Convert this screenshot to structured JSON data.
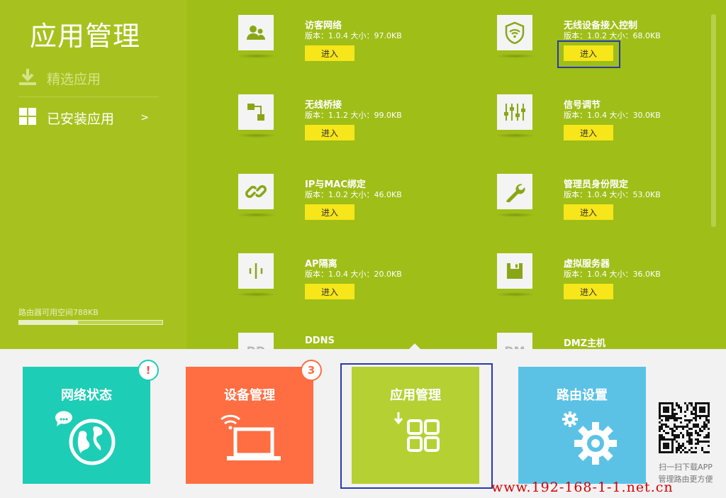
{
  "sidebar": {
    "title": "应用管理",
    "items": [
      {
        "label": "精选应用",
        "icon": "download-icon"
      },
      {
        "label": "已安装应用",
        "icon": "grid-icon",
        "chevron": ">"
      }
    ],
    "space_label": "路由器可用空间788KB",
    "space_used_fraction": 0.41
  },
  "apps": [
    {
      "name": "访客网络",
      "version": "版本：1.0.4 大小：97.0KB",
      "button": "进入",
      "icon": "guest-users-icon"
    },
    {
      "name": "无线设备接入控制",
      "version": "版本：1.0.2 大小：68.0KB",
      "button": "进入",
      "icon": "wifi-shield-icon",
      "focused": true
    },
    {
      "name": "无线桥接",
      "version": "版本：1.1.2 大小：99.0KB",
      "button": "进入",
      "icon": "bridge-icon"
    },
    {
      "name": "信号调节",
      "version": "版本：1.0.4 大小：30.0KB",
      "button": "进入",
      "icon": "signal-sliders-icon"
    },
    {
      "name": "IP与MAC绑定",
      "version": "版本：1.0.2 大小：46.0KB",
      "button": "进入",
      "icon": "link-icon"
    },
    {
      "name": "管理员身份限定",
      "version": "版本：1.0.4 大小：53.0KB",
      "button": "进入",
      "icon": "wrench-icon"
    },
    {
      "name": "AP隔离",
      "version": "版本：1.0.4 大小：20.0KB",
      "button": "进入",
      "icon": "ap-isolation-icon"
    },
    {
      "name": "虚拟服务器",
      "version": "版本：1.0.4 大小：36.0KB",
      "button": "进入",
      "icon": "save-disk-icon"
    },
    {
      "name": "DDNS",
      "icon_text": "DD",
      "icon": "ddns-icon"
    },
    {
      "name": "DMZ主机",
      "icon_text": "DM",
      "icon": "dmz-icon"
    }
  ],
  "tiles": [
    {
      "label": "网络状态",
      "color": "#1ecdb5",
      "icon": "globe-chat-icon",
      "badge": "!"
    },
    {
      "label": "设备管理",
      "color": "#ff6e42",
      "icon": "laptop-wifi-icon",
      "badge": "3"
    },
    {
      "label": "应用管理",
      "color": "#b4d033",
      "icon": "app-grid-icon",
      "selected": true
    },
    {
      "label": "路由设置",
      "color": "#5bc2e6",
      "icon": "gears-icon"
    }
  ],
  "qr": {
    "caption_line1": "扫一扫下载APP",
    "caption_line2": "管理路由更方便"
  },
  "watermark": "www.192-168-1-1.net.cn"
}
